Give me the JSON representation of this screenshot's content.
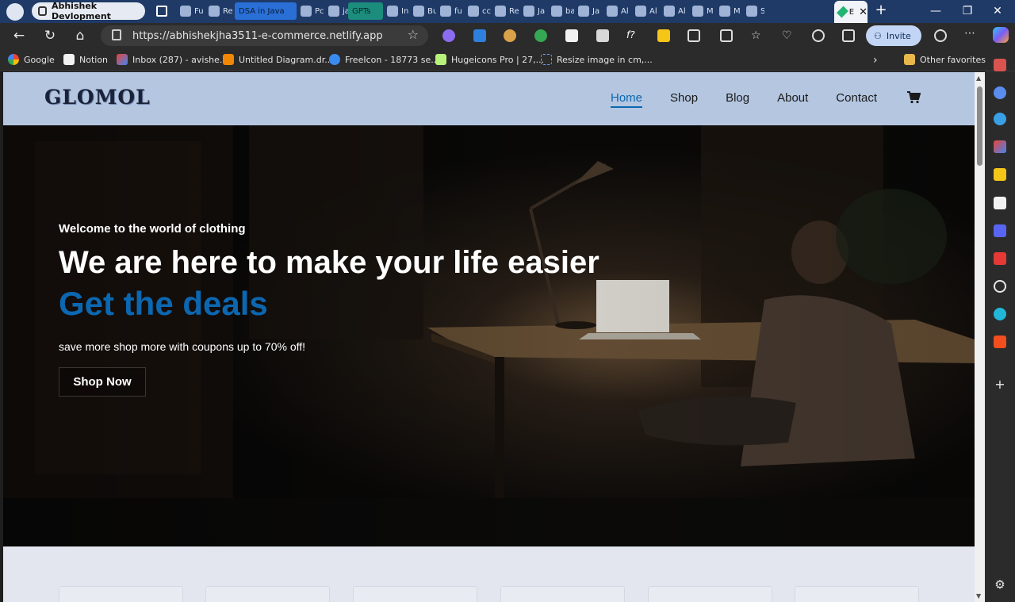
{
  "browser": {
    "profile_name": "Abhishek Devlopment",
    "tabs": [
      {
        "label": "Fu",
        "icon": "document-icon"
      },
      {
        "label": "Re",
        "icon": "github-icon"
      },
      {
        "label": "DSA in Java",
        "icon": "folder-tab-group"
      },
      {
        "label": "Pc",
        "icon": "document-icon"
      },
      {
        "label": "ja",
        "icon": "document-icon"
      },
      {
        "label": "GPTs",
        "icon": "tab-group"
      },
      {
        "label": "In",
        "icon": "link-icon"
      },
      {
        "label": "Bu",
        "icon": "edge-icon"
      },
      {
        "label": "fu",
        "icon": "arrow-icon"
      },
      {
        "label": "cc",
        "icon": "github-icon"
      },
      {
        "label": "Re",
        "icon": "chat-icon"
      },
      {
        "label": "Ja",
        "icon": "wordpress-icon"
      },
      {
        "label": "ba",
        "icon": "google-icon"
      },
      {
        "label": "Ja",
        "icon": "arrow-icon"
      },
      {
        "label": "Al",
        "icon": "react-icon"
      },
      {
        "label": "Al",
        "icon": "github-icon"
      },
      {
        "label": "Al",
        "icon": "github-icon"
      },
      {
        "label": "M",
        "icon": "drive-icon"
      },
      {
        "label": "M",
        "icon": "docs-icon"
      },
      {
        "label": "S",
        "icon": "diamond-icon"
      }
    ],
    "active_tab_label": "E",
    "url": "https://abhishekjha3511-e-commerce.netlify.app",
    "invite_label": "Invite",
    "bookmarks": [
      {
        "label": "Google",
        "icon": "google-icon"
      },
      {
        "label": "Notion",
        "icon": "notion-icon"
      },
      {
        "label": "Inbox (287) - avishe...",
        "icon": "gmail-icon"
      },
      {
        "label": "Untitled Diagram.dr...",
        "icon": "drawio-icon"
      },
      {
        "label": "FreeIcon - 18773 se...",
        "icon": "heart-icon"
      },
      {
        "label": "Hugeicons Pro | 27,...",
        "icon": "hugeicons-icon"
      },
      {
        "label": "Resize image in cm,...",
        "icon": "resize-icon"
      }
    ],
    "other_favorites": "Other favorites"
  },
  "site": {
    "logo": "GLOMOL",
    "nav": {
      "home": "Home",
      "shop": "Shop",
      "blog": "Blog",
      "about": "About",
      "contact": "Contact"
    },
    "hero": {
      "kicker": "Welcome to the world of clothing",
      "title": "We are here to make your life easier",
      "accent": "Get the deals",
      "subtitle": "save more shop more with coupons up to 70% off!",
      "cta": "Shop Now"
    }
  },
  "colors": {
    "accent": "#0c67b1",
    "header_bg": "#b4c6e0",
    "tabbar_bg": "#1f3a66"
  }
}
